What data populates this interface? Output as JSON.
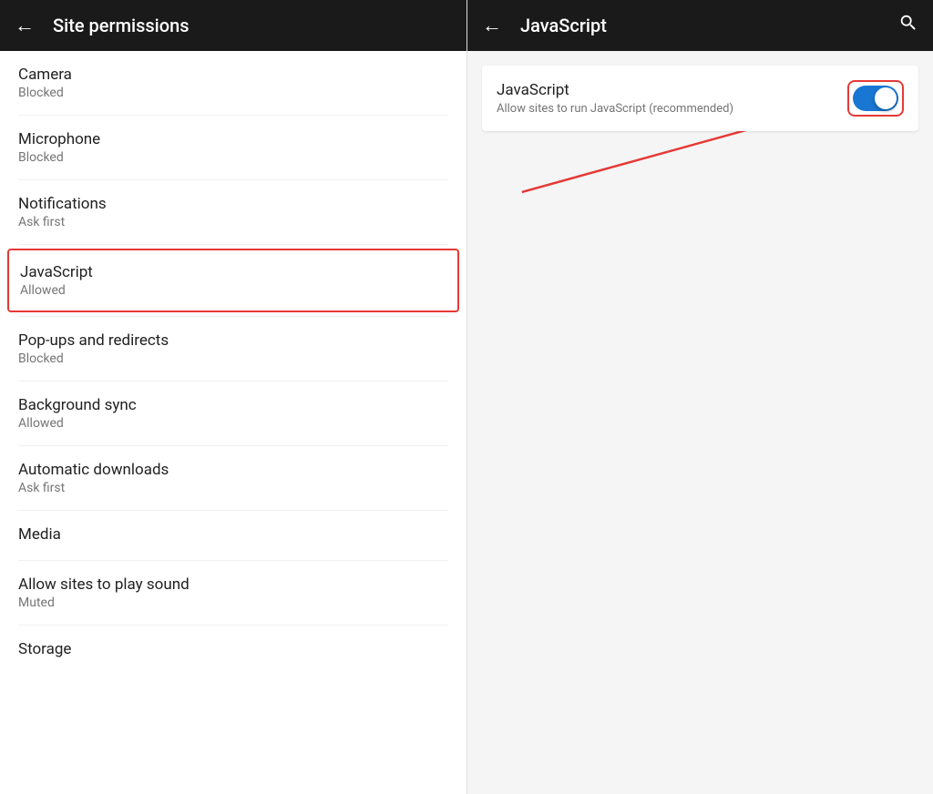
{
  "leftPanel": {
    "header": {
      "title": "Site permissions",
      "backIcon": "←"
    },
    "items": [
      {
        "id": "camera",
        "title": "Camera",
        "subtitle": "Blocked",
        "highlighted": false
      },
      {
        "id": "microphone",
        "title": "Microphone",
        "subtitle": "Blocked",
        "highlighted": false
      },
      {
        "id": "notifications",
        "title": "Notifications",
        "subtitle": "Ask first",
        "highlighted": false
      },
      {
        "id": "javascript",
        "title": "JavaScript",
        "subtitle": "Allowed",
        "highlighted": true
      },
      {
        "id": "popups",
        "title": "Pop-ups and redirects",
        "subtitle": "Blocked",
        "highlighted": false
      },
      {
        "id": "background-sync",
        "title": "Background sync",
        "subtitle": "Allowed",
        "highlighted": false
      },
      {
        "id": "automatic-downloads",
        "title": "Automatic downloads",
        "subtitle": "Ask first",
        "highlighted": false
      },
      {
        "id": "media",
        "title": "Media",
        "subtitle": "",
        "highlighted": false
      },
      {
        "id": "allow-sound",
        "title": "Allow sites to play sound",
        "subtitle": "Muted",
        "highlighted": false
      },
      {
        "id": "storage",
        "title": "Storage",
        "subtitle": "",
        "highlighted": false
      }
    ]
  },
  "rightPanel": {
    "header": {
      "title": "JavaScript",
      "backIcon": "←",
      "searchIcon": "🔍"
    },
    "setting": {
      "title": "JavaScript",
      "description": "Allow sites to run JavaScript (recommended)",
      "enabled": true
    }
  }
}
